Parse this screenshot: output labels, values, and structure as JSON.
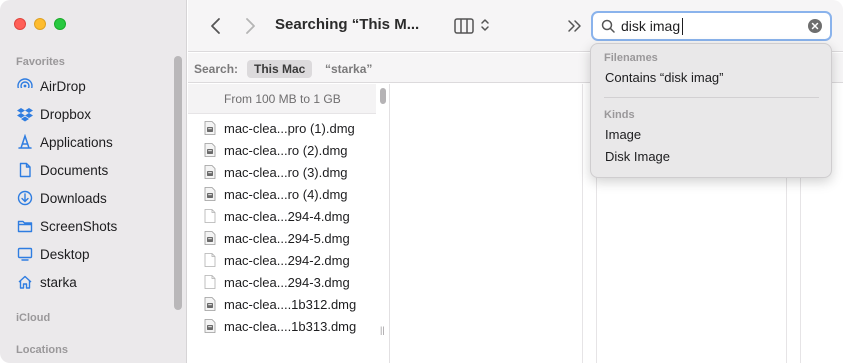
{
  "window": {
    "title": "Searching “This M...",
    "traffic_lights": {
      "close": "#ff5f57",
      "minimize": "#febc2e",
      "zoom": "#28c840"
    }
  },
  "sidebar": {
    "favorites_heading": "Favorites",
    "items": [
      {
        "label": "AirDrop",
        "icon": "airdrop-icon"
      },
      {
        "label": "Dropbox",
        "icon": "dropbox-icon"
      },
      {
        "label": "Applications",
        "icon": "applications-icon"
      },
      {
        "label": "Documents",
        "icon": "document-icon"
      },
      {
        "label": "Downloads",
        "icon": "downloads-icon"
      },
      {
        "label": "ScreenShots",
        "icon": "folder-icon"
      },
      {
        "label": "Desktop",
        "icon": "desktop-icon"
      },
      {
        "label": "starka",
        "icon": "home-icon"
      }
    ],
    "icloud_heading": "iCloud",
    "locations_heading": "Locations",
    "accent": "#2f7de1"
  },
  "search": {
    "value": "disk imag",
    "accent": "#8ab3ec"
  },
  "scope": {
    "label": "Search:",
    "this_mac": "This Mac",
    "user": "“starka”"
  },
  "results": {
    "group_header": "From 100 MB to 1 GB",
    "files": [
      {
        "name": "mac-clea...pro (1).dmg",
        "icon": "dmg-file-icon"
      },
      {
        "name": "mac-clea...ro (2).dmg",
        "icon": "dmg-file-icon"
      },
      {
        "name": "mac-clea...ro (3).dmg",
        "icon": "dmg-file-icon"
      },
      {
        "name": "mac-clea...ro (4).dmg",
        "icon": "dmg-file-icon"
      },
      {
        "name": "mac-clea...294-4.dmg",
        "icon": "blank-file-icon"
      },
      {
        "name": "mac-clea...294-5.dmg",
        "icon": "dmg-file-icon"
      },
      {
        "name": "mac-clea...294-2.dmg",
        "icon": "blank-file-icon"
      },
      {
        "name": "mac-clea...294-3.dmg",
        "icon": "blank-file-icon"
      },
      {
        "name": "mac-clea....1b312.dmg",
        "icon": "dmg-file-icon"
      },
      {
        "name": "mac-clea....1b313.dmg",
        "icon": "dmg-file-icon"
      }
    ]
  },
  "suggestions": {
    "filenames_heading": "Filenames",
    "filenames_item": "Contains “disk imag”",
    "kinds_heading": "Kinds",
    "kinds_items": [
      "Image",
      "Disk Image"
    ]
  }
}
